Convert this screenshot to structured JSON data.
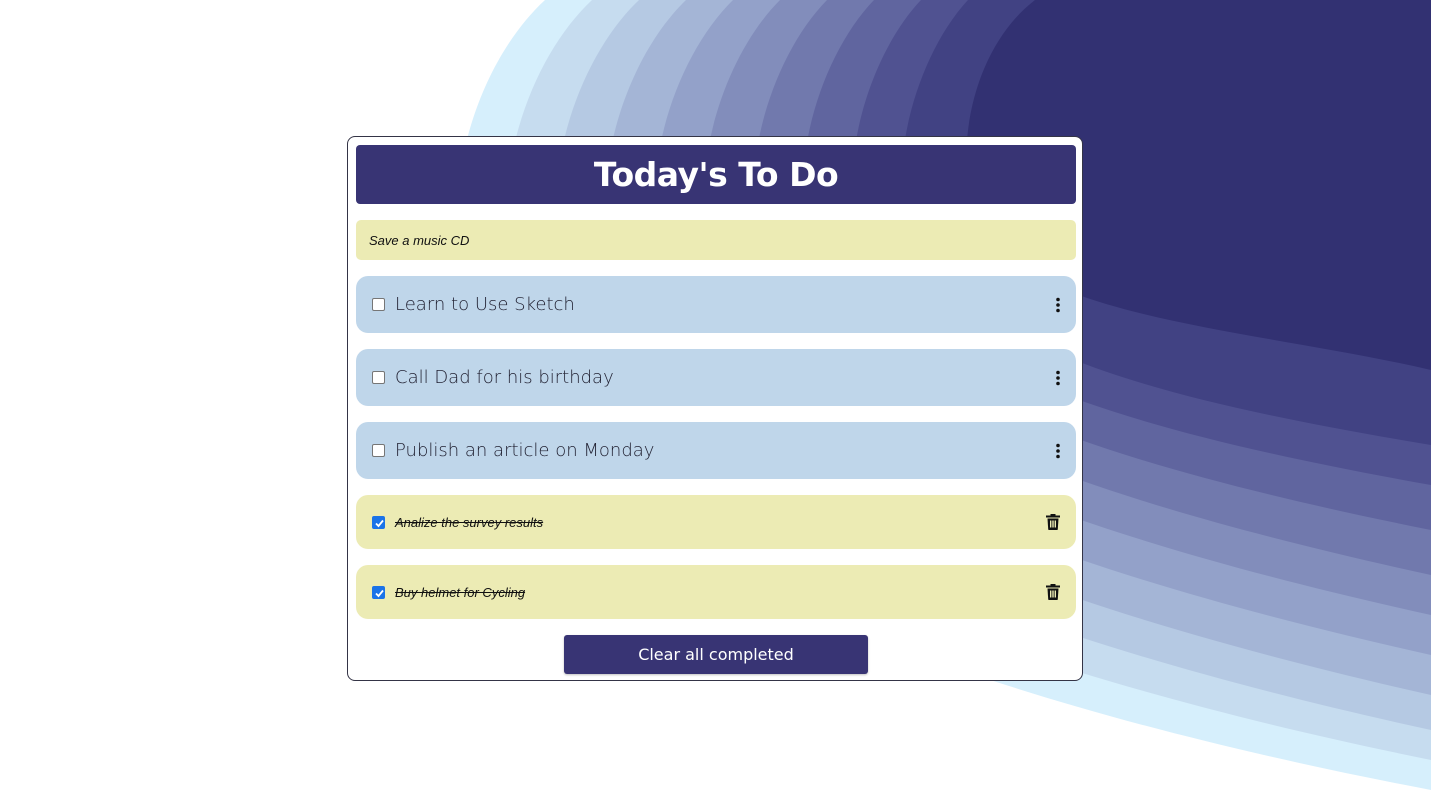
{
  "header": {
    "title": "Today's To Do"
  },
  "new_task": {
    "text": "Save a music CD"
  },
  "tasks": [
    {
      "label": "Learn to Use Sketch",
      "completed": false,
      "action_icon": "kebab-menu-icon"
    },
    {
      "label": "Call Dad for his birthday",
      "completed": false,
      "action_icon": "kebab-menu-icon"
    },
    {
      "label": "Publish an article on Monday",
      "completed": false,
      "action_icon": "kebab-menu-icon"
    },
    {
      "label": "Analize the survey results ",
      "completed": true,
      "action_icon": "trash-icon"
    },
    {
      "label": "Buy helmet for Cycling",
      "completed": true,
      "action_icon": "trash-icon"
    }
  ],
  "footer": {
    "clear_label": "Clear all completed"
  },
  "colors": {
    "primary": "#383474",
    "open_task_bg": "#bfd6ea",
    "completed_task_bg": "#ecebb4",
    "checkbox_checked": "#1a73e8",
    "wave_dark": "#323172",
    "wave_light": "#d6effc"
  }
}
